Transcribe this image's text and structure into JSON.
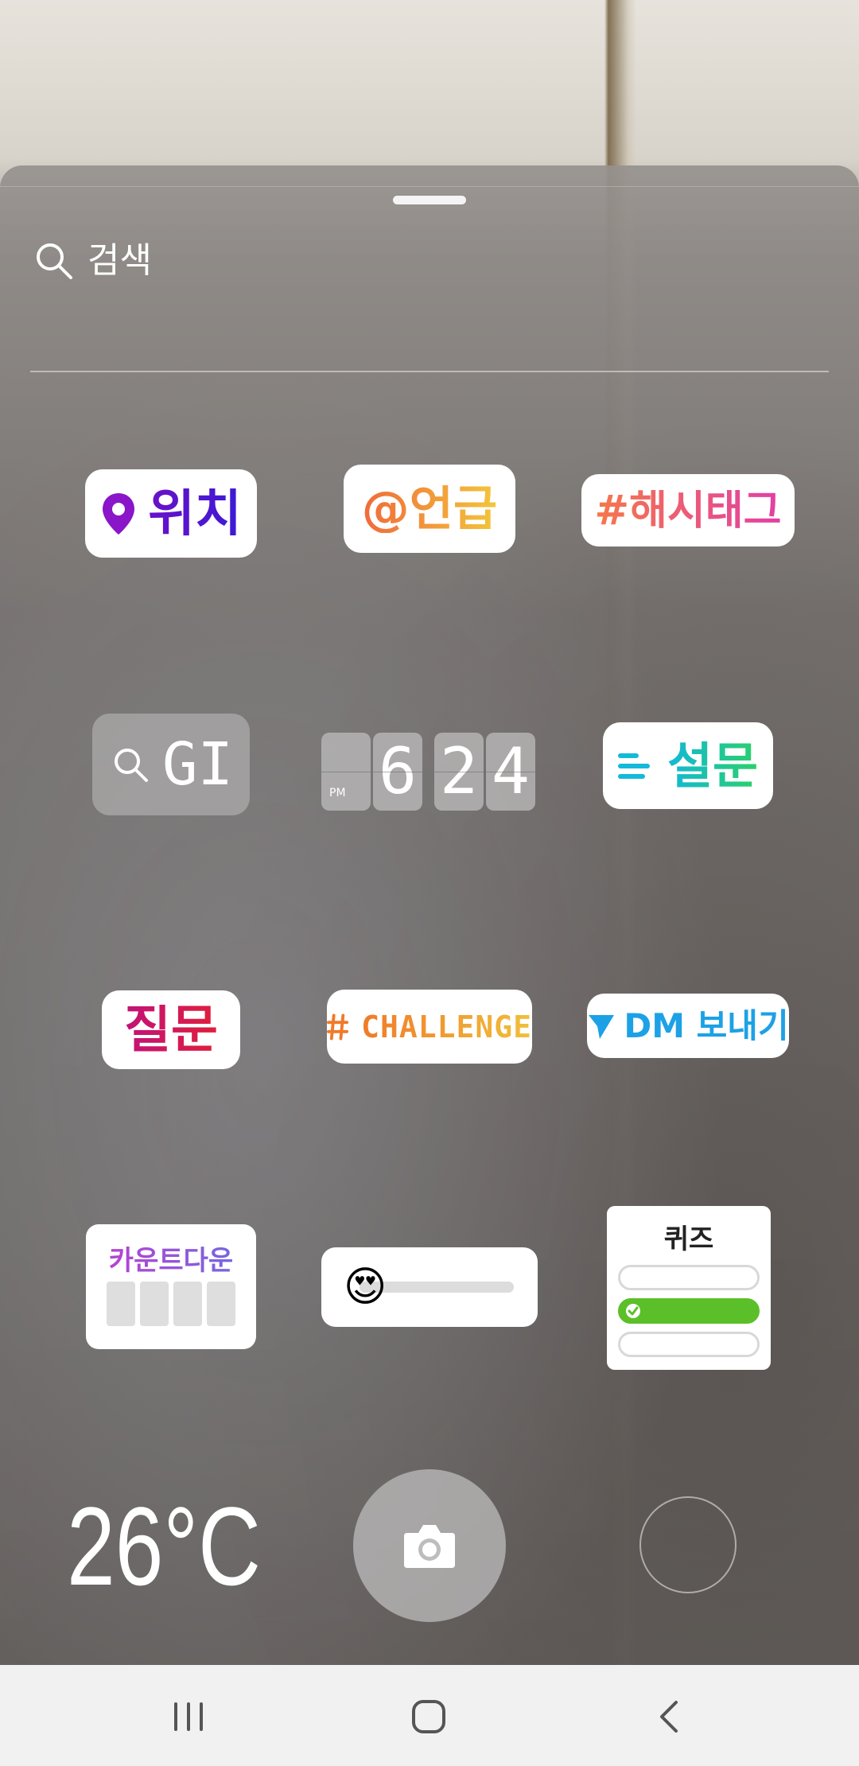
{
  "search": {
    "placeholder": "검색"
  },
  "stickers": {
    "location": "위치",
    "mention": "@언급",
    "hashtag": "#해시태그",
    "gif": "GI",
    "time": {
      "digits": [
        "6",
        "2",
        "4"
      ],
      "period": "PM"
    },
    "poll": "설문",
    "question": "질문",
    "challenge": "CHALLENGE",
    "dm": "DM 보내기",
    "countdown": "카운트다운",
    "emoji_slider": {
      "emoji": "😍"
    },
    "quiz": "퀴즈"
  },
  "camera": {
    "temperature": "26°C"
  },
  "colors": {
    "location": "#6b10c9",
    "mention": "#f06a3a",
    "hashtag": "#e23ea6",
    "poll": "#2bd06a",
    "question": "#c2127a",
    "challenge": "#f07a2a",
    "dm": "#1da1e6",
    "quiz_correct": "#5bbf2a"
  },
  "icons": [
    "search-icon",
    "location-pin-icon",
    "poll-lines-icon",
    "challenge-hash-icon",
    "send-icon",
    "camera-icon",
    "check-icon",
    "recent-apps-icon",
    "home-icon",
    "back-icon"
  ]
}
